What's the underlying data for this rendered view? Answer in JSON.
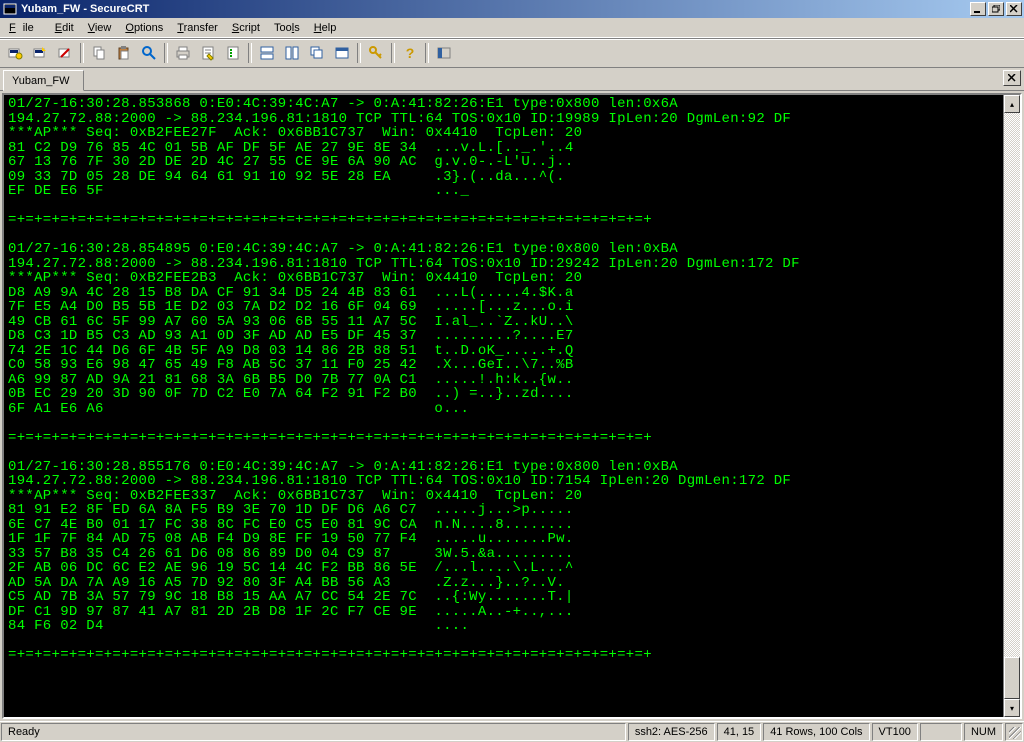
{
  "window": {
    "title": "Yubam_FW - SecureCRT"
  },
  "menu": {
    "file": "File",
    "edit": "Edit",
    "view": "View",
    "options": "Options",
    "transfer": "Transfer",
    "script": "Script",
    "tools": "Tools",
    "help": "Help"
  },
  "toolbar_icons": [
    "reconnect-icon",
    "quick-connect-icon",
    "disconnect-icon",
    "copy-icon",
    "paste-icon",
    "find-icon",
    "print-icon",
    "properties-icon",
    "options-icon",
    "folder-icon",
    "session-icon",
    "tile-icon",
    "cascade-icon",
    "key-icon",
    "help-icon",
    "toggle-icon"
  ],
  "tab": {
    "label": "Yubam_FW"
  },
  "terminal_lines": [
    "01/27-16:30:28.853868 0:E0:4C:39:4C:A7 -> 0:A:41:82:26:E1 type:0x800 len:0x6A",
    "194.27.72.88:2000 -> 88.234.196.81:1810 TCP TTL:64 TOS:0x10 ID:19989 IpLen:20 DgmLen:92 DF",
    "***AP*** Seq: 0xB2FEE27F  Ack: 0x6BB1C737  Win: 0x4410  TcpLen: 20",
    "81 C2 D9 76 85 4C 01 5B AF DF 5F AE 27 9E 8E 34  ...v.L.[.._.'..4",
    "67 13 76 7F 30 2D DE 2D 4C 27 55 CE 9E 6A 90 AC  g.v.0-.-L'U..j..",
    "09 33 7D 05 28 DE 94 64 61 91 10 92 5E 28 EA     .3}.(..da...^(.",
    "EF DE E6 5F                                      ..._",
    "",
    "=+=+=+=+=+=+=+=+=+=+=+=+=+=+=+=+=+=+=+=+=+=+=+=+=+=+=+=+=+=+=+=+=+=+=+=+=+",
    "",
    "01/27-16:30:28.854895 0:E0:4C:39:4C:A7 -> 0:A:41:82:26:E1 type:0x800 len:0xBA",
    "194.27.72.88:2000 -> 88.234.196.81:1810 TCP TTL:64 TOS:0x10 ID:29242 IpLen:20 DgmLen:172 DF",
    "***AP*** Seq: 0xB2FEE2B3  Ack: 0x6BB1C737  Win: 0x4410  TcpLen: 20",
    "D8 A9 9A 4C 28 15 B8 DA CF 91 34 D5 24 4B 83 61  ...L(.....4.$K.a",
    "7F E5 A4 D0 B5 5B 1E D2 03 7A D2 D2 16 6F 04 69  .....[...z...o.i",
    "49 CB 61 6C 5F 99 A7 60 5A 93 06 6B 55 11 A7 5C  I.al_..`Z..kU..\\",
    "D8 C3 1D B5 C3 AD 93 A1 0D 3F AD AD E5 DF 45 37  .........?....E7",
    "74 2E 1C 44 D6 6F 4B 5F A9 D8 03 14 86 2B 88 51  t..D.oK_.....+.Q",
    "C0 58 93 E6 98 47 65 49 F8 AB 5C 37 11 F0 25 42  .X...GeI..\\7..%B",
    "A6 99 87 AD 9A 21 81 68 3A 6B B5 D0 7B 77 0A C1  .....!.h:k..{w..",
    "0B EC 29 20 3D 90 0F 7D C2 E0 7A 64 F2 91 F2 B0  ..) =..}..zd....",
    "6F A1 E6 A6                                      o...",
    "",
    "=+=+=+=+=+=+=+=+=+=+=+=+=+=+=+=+=+=+=+=+=+=+=+=+=+=+=+=+=+=+=+=+=+=+=+=+=+",
    "",
    "01/27-16:30:28.855176 0:E0:4C:39:4C:A7 -> 0:A:41:82:26:E1 type:0x800 len:0xBA",
    "194.27.72.88:2000 -> 88.234.196.81:1810 TCP TTL:64 TOS:0x10 ID:7154 IpLen:20 DgmLen:172 DF",
    "***AP*** Seq: 0xB2FEE337  Ack: 0x6BB1C737  Win: 0x4410  TcpLen: 20",
    "81 91 E2 8F ED 6A 8A F5 B9 3E 70 1D DF D6 A6 C7  .....j...>p.....",
    "6E C7 4E B0 01 17 FC 38 8C FC E0 C5 E0 81 9C CA  n.N....8........",
    "1F 1F 7F 84 AD 75 08 AB F4 D9 8E FF 19 50 77 F4  .....u.......Pw.",
    "33 57 B8 35 C4 26 61 D6 08 86 89 D0 04 C9 87     3W.5.&a.........",
    "2F AB 06 DC 6C E2 AE 96 19 5C 14 4C F2 BB 86 5E  /...l....\\.L...^",
    "AD 5A DA 7A A9 16 A5 7D 92 80 3F A4 BB 56 A3     .Z.z...}..?..V.",
    "C5 AD 7B 3A 57 79 9C 18 B8 15 AA A7 CC 54 2E 7C  ..{:Wy.......T.|",
    "DF C1 9D 97 87 41 A7 81 2D 2B D8 1F 2C F7 CE 9E  .....A..-+..,...",
    "84 F6 02 D4                                      ....",
    "",
    "=+=+=+=+=+=+=+=+=+=+=+=+=+=+=+=+=+=+=+=+=+=+=+=+=+=+=+=+=+=+=+=+=+=+=+=+=+"
  ],
  "status": {
    "ready": "Ready",
    "encryption": "ssh2: AES-256",
    "cursor": "41, 15",
    "size": "41 Rows, 100 Cols",
    "term": "VT100",
    "numlock": "NUM"
  }
}
